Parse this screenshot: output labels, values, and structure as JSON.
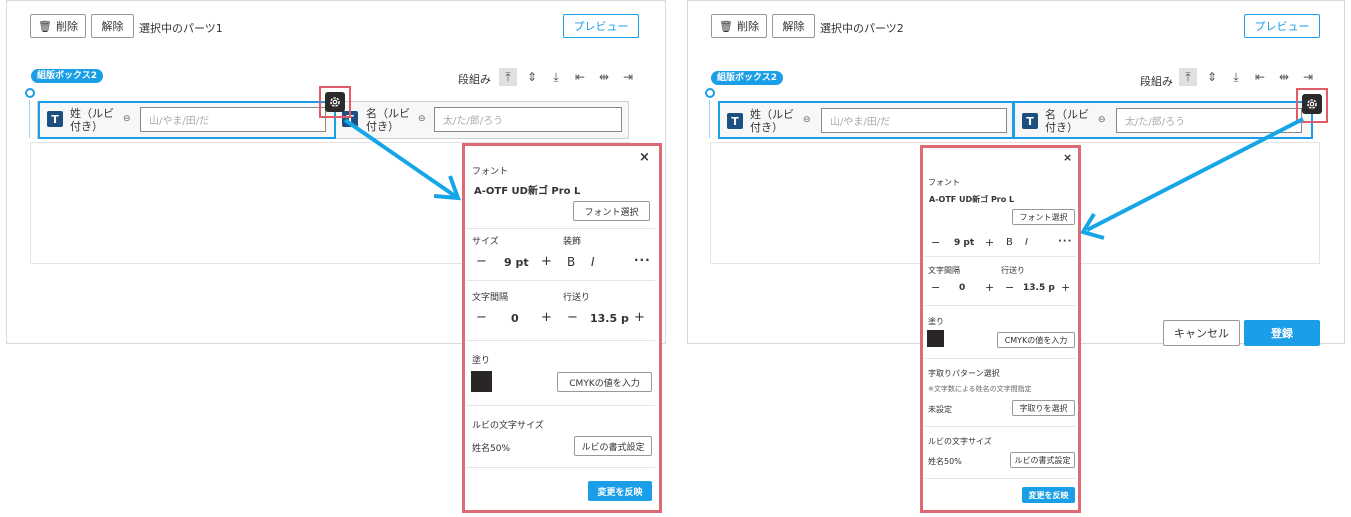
{
  "left": {
    "toolbar": {
      "delete": "削除",
      "release": "解除",
      "selected": "選択中のパーツ1",
      "preview": "プレビュー"
    },
    "chip": "組版ボックス2",
    "column_label": "段組み",
    "fields": [
      {
        "label_line1": "姓（ルビ",
        "label_line2": "付き）",
        "placeholder": "山/やま/田/だ"
      },
      {
        "label_line1": "名（ルビ",
        "label_line2": "付き）",
        "placeholder": "太/た/郎/ろう"
      }
    ],
    "popup": {
      "close": "×",
      "font_heading": "フォント",
      "font_name": "A-OTF UD新ゴ Pro L",
      "font_select": "フォント選択",
      "size_heading": "サイズ",
      "decoration_heading": "装飾",
      "size_value": "9 pt",
      "minus": "−",
      "plus": "+",
      "bold": "B",
      "italic": "I",
      "more": "···",
      "spacing_heading": "文字間隔",
      "leading_heading": "行送り",
      "spacing_value": "0",
      "leading_value": "13.5 p",
      "fill_heading": "塗り",
      "cmyk": "CMYKの値を入力",
      "ruby_heading": "ルビの文字サイズ",
      "ruby_value": "姓名50%",
      "ruby_format": "ルビの書式設定",
      "apply": "変更を反映"
    }
  },
  "right": {
    "toolbar": {
      "delete": "削除",
      "release": "解除",
      "selected": "選択中のパーツ2",
      "preview": "プレビュー"
    },
    "chip": "組版ボックス2",
    "column_label": "段組み",
    "fields": [
      {
        "label_line1": "姓（ルビ",
        "label_line2": "付き）",
        "placeholder": "山/やま/田/だ"
      },
      {
        "label_line1": "名（ルビ",
        "label_line2": "付き）",
        "placeholder": "太/た/郎/ろう"
      }
    ],
    "cancel": "キャンセル",
    "register": "登録",
    "popup": {
      "close": "×",
      "font_heading": "フォント",
      "font_name": "A-OTF UD新ゴ Pro L",
      "font_select": "フォント選択",
      "size_value": "9 pt",
      "minus": "−",
      "plus": "+",
      "bold": "B",
      "italic": "I",
      "more": "···",
      "spacing_heading": "文字間隔",
      "leading_heading": "行送り",
      "spacing_value": "0",
      "leading_value": "13.5 p",
      "fill_heading": "塗り",
      "cmyk": "CMYKの値を入力",
      "pattern_heading": "字取りパターン選択",
      "pattern_note": "※文字数による姓名の文字間指定",
      "pattern_value": "未設定",
      "pattern_select": "字取りを選択",
      "ruby_heading": "ルビの文字サイズ",
      "ruby_value": "姓名50%",
      "ruby_format": "ルビの書式設定",
      "apply": "変更を反映"
    }
  },
  "colors": {
    "accent": "#1a9ee8",
    "highlight_red": "#e05c66",
    "fill_swatch": "#2a2625",
    "t_icon": "#1d4f80"
  }
}
